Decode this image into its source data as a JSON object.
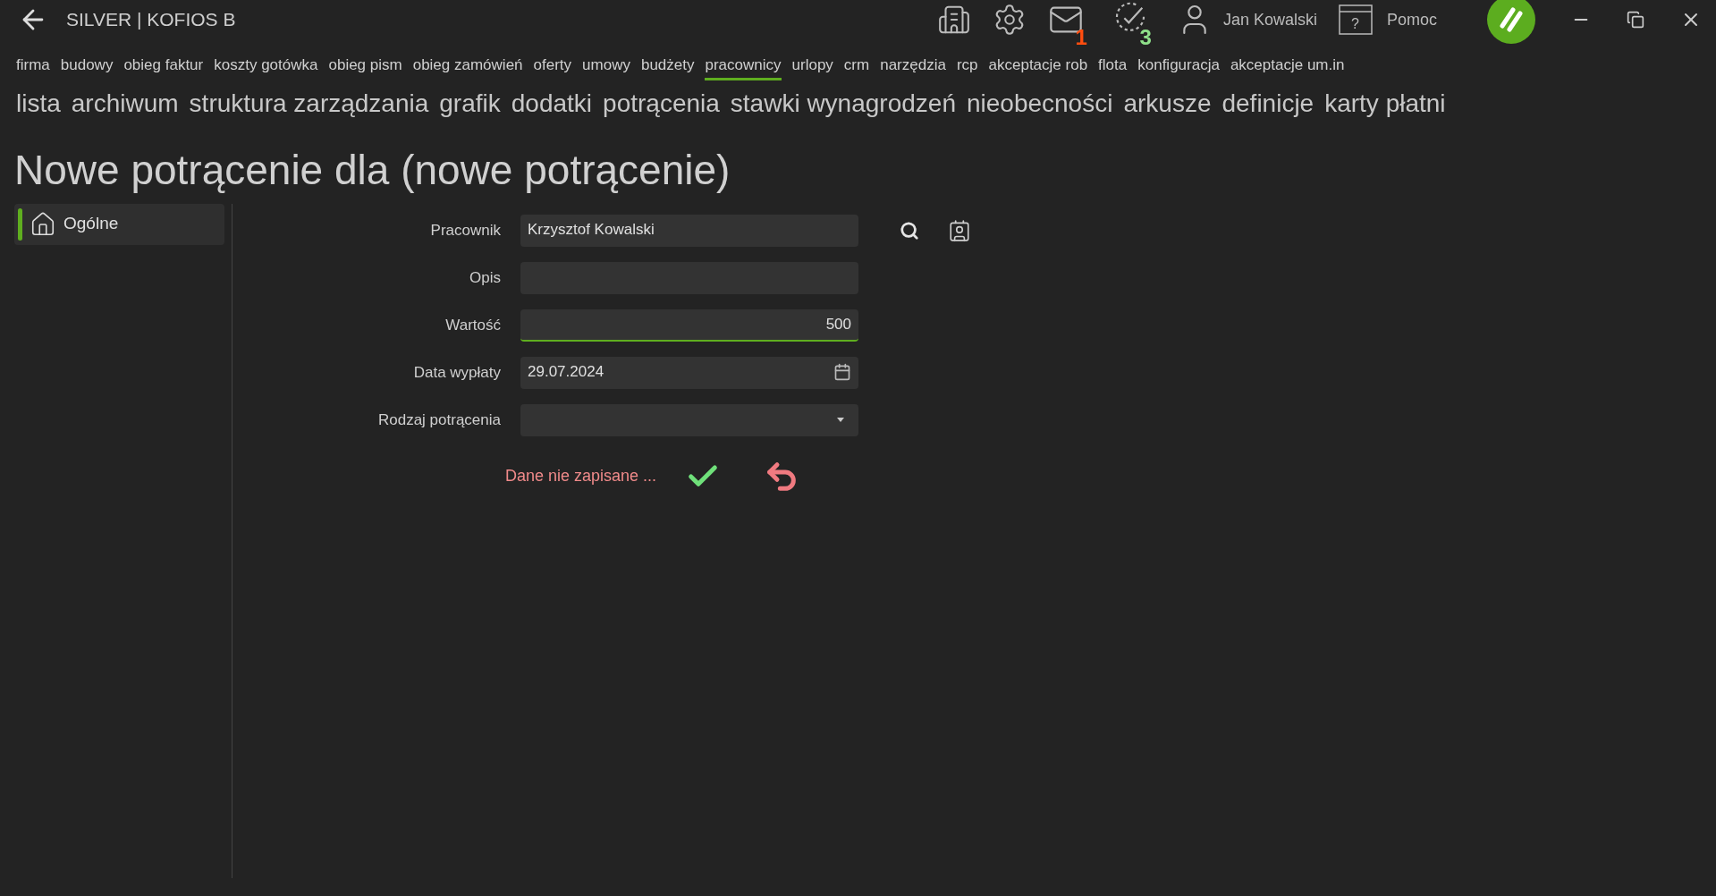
{
  "window": {
    "title": "SILVER | KOFIOS B"
  },
  "toolbar": {
    "mail_badge": "1",
    "tasks_badge": "3",
    "user": "Jan Kowalski",
    "help": "Pomoc",
    "help_icon_glyph": "?"
  },
  "menu": [
    {
      "label": "firma",
      "selected": false
    },
    {
      "label": "budowy",
      "selected": false
    },
    {
      "label": "obieg faktur",
      "selected": false
    },
    {
      "label": "koszty gotówka",
      "selected": false
    },
    {
      "label": "obieg pism",
      "selected": false
    },
    {
      "label": "obieg zamówień",
      "selected": false
    },
    {
      "label": "oferty",
      "selected": false
    },
    {
      "label": "umowy",
      "selected": false
    },
    {
      "label": "budżety",
      "selected": false
    },
    {
      "label": "pracownicy",
      "selected": true
    },
    {
      "label": "urlopy",
      "selected": false
    },
    {
      "label": "crm",
      "selected": false
    },
    {
      "label": "narzędzia",
      "selected": false
    },
    {
      "label": "rcp",
      "selected": false
    },
    {
      "label": "akceptacje rob",
      "selected": false
    },
    {
      "label": "flota",
      "selected": false
    },
    {
      "label": "konfiguracja",
      "selected": false
    },
    {
      "label": "akceptacje um.in",
      "selected": false
    }
  ],
  "submenu": [
    "lista",
    "archiwum",
    "struktura zarządzania",
    "grafik",
    "dodatki",
    "potrącenia",
    "stawki wynagrodzeń",
    "nieobecności",
    "arkusze",
    "definicje",
    "karty płatni"
  ],
  "heading": "Nowe potrącenie dla (nowe potrącenie)",
  "sidebar": {
    "items": [
      {
        "label": "Ogólne",
        "selected": true
      }
    ]
  },
  "form": {
    "fields": [
      {
        "kind": "lookup",
        "label": "Pracownik",
        "value": "Krzysztof Kowalski",
        "focused": false
      },
      {
        "kind": "text",
        "label": "Opis",
        "focused": false
      },
      {
        "kind": "number",
        "label": "Wartość",
        "value": "500",
        "focused": true
      },
      {
        "kind": "date",
        "label": "Data wypłaty",
        "value": "29.07.2024",
        "focused": false
      },
      {
        "kind": "select",
        "label": "Rodzaj potrącenia",
        "focused": false
      }
    ],
    "status": "Dane nie zapisane ..."
  }
}
